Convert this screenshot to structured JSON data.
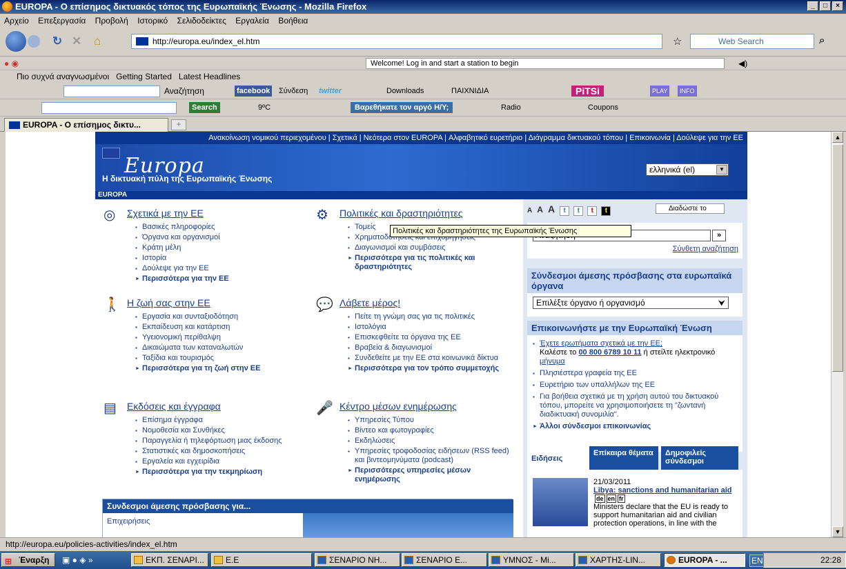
{
  "window": {
    "title": "EUROPA - Ο επίσημος δικτυακός τόπος της Ευρωπαϊκής Ένωσης - Mozilla Firefox",
    "min": "_",
    "max": "□",
    "close": "×"
  },
  "menu": [
    "Αρχείο",
    "Επεξεργασία",
    "Προβολή",
    "Ιστορικό",
    "Σελιδοδείκτες",
    "Εργαλεία",
    "Βοήθεια"
  ],
  "nav": {
    "url": "http://europa.eu/index_el.htm",
    "websearch": "Web Search"
  },
  "toolbar1": {
    "radio_text": "Welcome! Log in and start a station to begin"
  },
  "bookmarks": [
    "Πιο συχνά αναγνωσμένοι",
    "Getting Started",
    "Latest Headlines"
  ],
  "toolbar2": {
    "search": "Αναζήτηση",
    "facebook": "facebook",
    "fb_login": "Σύνδεση",
    "twitter": "twitter",
    "downloads": "Downloads",
    "games": "ΠΑΙΧΝΙΔΙΑ",
    "pitsi": "PiTSi",
    "play": "PLAY",
    "info": "INFO"
  },
  "toolbar3": {
    "search_btn": "Search",
    "temp": "9ºC",
    "slow_pc": "Βαρεθήκατε τον αργό Η/Υ;",
    "radio": "Radio",
    "coupons": "Coupons"
  },
  "tab": {
    "title": "EUROPA - Ο επίσημος δικτυ..."
  },
  "page": {
    "toplinks": "Ανακοίνωση νομικού περιεχομένου | Σχετικά | Νεότερα στον EUROPA | Αλφαβητικό ευρετήριο | Διάγραμμα δικτυακού τόπου | Επικοινωνία | Δούλεψε για την ΕΕ",
    "logo": "Europa",
    "subtitle": "Η δικτυακή πύλη της Ευρωπαϊκής Ένωσης",
    "language": "ελληνικά (el)",
    "europa_label": "EUROPA",
    "sections": [
      {
        "title": "Σχετικά με την ΕΕ",
        "items": [
          "Βασικές πληροφορίες",
          "Όργανα και οργανισμοί",
          "Κράτη μέλη",
          "Ιστορία",
          "Δούλεψε για την ΕΕ"
        ],
        "more": "Περισσότερα για την ΕΕ"
      },
      {
        "title": "Πολιτικές και δραστηριότητες",
        "items": [
          "Τομείς",
          "Χρηματοδοτήσεις και επιχορηγήσεις",
          "Διαγωνισμοί και συμβάσεις"
        ],
        "more": "Περισσότερα για τις πολιτικές και δραστηριότητες"
      },
      {
        "title": "Η ζωή σας στην ΕΕ",
        "items": [
          "Εργασία και συνταξιοδότηση",
          "Εκπαίδευση και κατάρτιση",
          "Υγειονομική περίθαλψη",
          "Δικαιώματα των καταναλωτών",
          "Ταξίδια και τουρισμός"
        ],
        "more": "Περισσότερα για τη ζωή στην ΕΕ"
      },
      {
        "title": "Λάβετε μέρος!",
        "items": [
          "Πείτε τη γνώμη σας για τις πολιτικές",
          "Ιστολόγια",
          "Επισκεφθείτε τα όργανα της ΕΕ",
          "Βραβεία & διαγωνισμοί",
          "Συνδεθείτε με την ΕΕ στα κοινωνικά δίκτυα"
        ],
        "more": "Περισσότερα για τον τρόπο συμμετοχής"
      },
      {
        "title": "Εκδόσεις και έγγραφα",
        "items": [
          "Επίσημα έγγραφα",
          "Νομοθεσία και Συνθήκες",
          "Παραγγελία ή τηλεφόρτωση μιας έκδοσης",
          "Στατιστικές και δημοσκοπήσεις",
          "Εργαλεία και εγχειρίδια"
        ],
        "more": "Περισσότερα για την τεκμηρίωση"
      },
      {
        "title": "Κέντρο μέσων ενημέρωσης",
        "items": [
          "Υπηρεσίες Τύπου",
          "Βίντεο και φωτογραφίες",
          "Εκδηλώσεις",
          "Υπηρεσίες τροφοδοσίας ειδήσεων (RSS feed) και βιντεομηνύματα (podcast)"
        ],
        "more": "Περισσότερες υπηρεσίες μέσων ενημέρωσης"
      }
    ],
    "tooltip": "Πολιτικές και δραστηριότητες της Ευρωπαϊκής Ένωσης",
    "direct_links": {
      "title": "Συνδεσμοι άμεσης πρόσβασης για...",
      "item": "Επιχειρήσεις"
    },
    "right": {
      "share": "Διαδώστε το",
      "search_placeholder": "Αναζήτηση",
      "advanced": "Σύνθετη αναζήτηση",
      "organs_title": "Σύνδεσμοι άμεσης πρόσβασης στα ευρωπαϊκά όργανα",
      "organs_select": "Επιλέξτε όργανο ή οργανισμό",
      "contact_title": "Επικοινωνήστε με την Ευρωπαϊκή Ένωση",
      "contact_q": "Έχετε ερωτήματα σχετικά με την ΕΕ;",
      "contact_call": "Καλέστε το",
      "contact_phone": "00 800 6789 10 11",
      "contact_or": "ή στείλτε ηλεκτρονικό",
      "contact_msg": "μήνυμα",
      "contact_links": [
        "Πλησιέστερα γραφεία της ΕΕ",
        "Ευρετήριο των υπαλλήλων της ΕΕ",
        "Για βοήθεια σχετικά με τη χρήση αυτού του δικτυακού τόπου, μπορείτε να χρησιμοποιήσετε τη \"ζωντανή διαδικτυακή συνομιλία\"."
      ],
      "contact_more": "Άλλοι σύνδεσμοι επικοινωνίας",
      "news_tabs": [
        "Ειδήσεις",
        "Επίκαιρα θέματα",
        "Δημοφιλείς σύνδεσμοι"
      ],
      "news_date": "21/03/2011",
      "news_title": "Libya: sanctions and humanitarian aid",
      "news_langs": [
        "de",
        "en",
        "fr"
      ],
      "news_text": "Ministers declare that the EU is ready to support humanitarian aid and civilian protection operations, in line with the"
    }
  },
  "status": "http://europa.eu/policies-activities/index_el.htm",
  "taskbar": {
    "start": "Έναρξη",
    "tasks": [
      "ΕΚΠ. ΣΕΝΑΡΙ...",
      "Ε.Ε",
      "ΣΕΝΑΡΙΟ ΝΗ...",
      "ΣΕΝΑΡΙΟ Ε...",
      "ΥΜΝΟΣ - Mi...",
      "ΧΑΡΤΗΣ-LIN...",
      "EUROPA - ..."
    ],
    "lang": "EN",
    "time": "22:28"
  }
}
